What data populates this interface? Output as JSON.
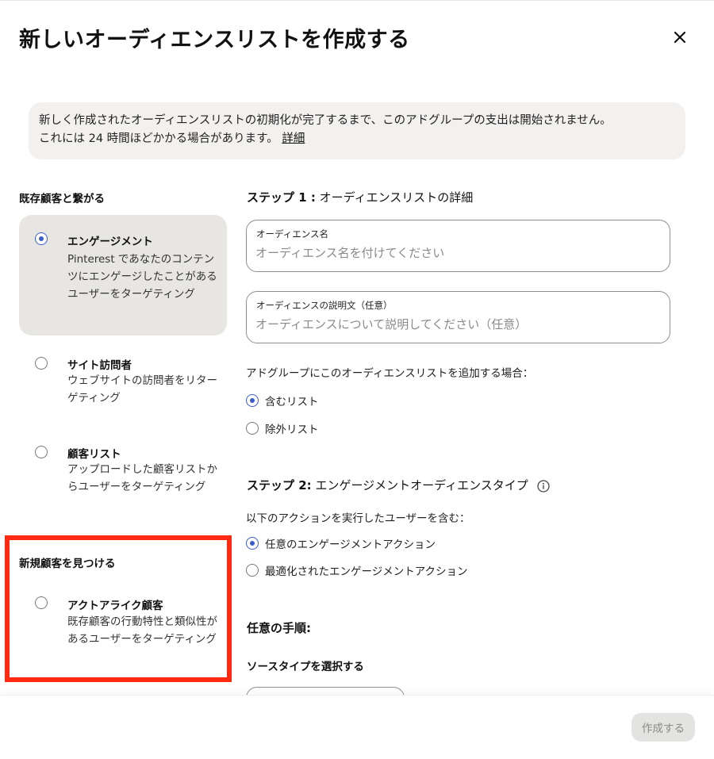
{
  "modal": {
    "title": "新しいオーディエンスリストを作成する"
  },
  "notice": {
    "line1": "新しく作成されたオーディエンスリストの初期化が完了するまで、このアドグループの支出は開始されません。",
    "line2": "これには 24 時間ほどかかる場合があります。",
    "link": "詳細"
  },
  "left": {
    "existing_heading": "既存顧客と繋がる",
    "new_heading": "新規顧客を見つける",
    "options": [
      {
        "title": "エンゲージメント",
        "description": "Pinterest であなたのコンテンツにエンゲージしたことがあるユーザーをターゲティング",
        "selected": true
      },
      {
        "title": "サイト訪問者",
        "description": "ウェブサイトの訪問者をリターゲティング",
        "selected": false
      },
      {
        "title": "顧客リスト",
        "description": "アップロードした顧客リストからユーザーをターゲティング",
        "selected": false
      },
      {
        "title": "アクトアライク顧客",
        "description": "既存顧客の行動特性と類似性があるユーザーをターゲティング",
        "selected": false
      }
    ]
  },
  "step1": {
    "prefix": "ステップ 1 :",
    "title": " オーディエンスリストの詳細",
    "name_label": "オーディエンス名",
    "name_placeholder": "オーディエンス名を付けてください",
    "desc_label": "オーディエンスの説明文（任意）",
    "desc_placeholder": "オーディエンスについて説明してください（任意）",
    "add_prompt": "アドグループにこのオーディエンスリストを追加する場合：",
    "include_label": "含むリスト",
    "exclude_label": "除外リスト",
    "selected": "include"
  },
  "step2": {
    "prefix": "ステップ 2:",
    "title": " エンゲージメントオーディエンスタイプ",
    "action_prompt": "以下のアクションを実行したユーザーを含む：",
    "any_label": "任意のエンゲージメントアクション",
    "optimized_label": "最適化されたエンゲージメントアクション",
    "selected": "any"
  },
  "optional": {
    "title": "任意の手順:",
    "source_heading": "ソースタイプを選択する"
  },
  "footer": {
    "create_label": "作成する"
  },
  "colors": {
    "accent": "#3b5ccc",
    "highlight": "#ff2a12",
    "selected_card": "#e7e6e3"
  }
}
